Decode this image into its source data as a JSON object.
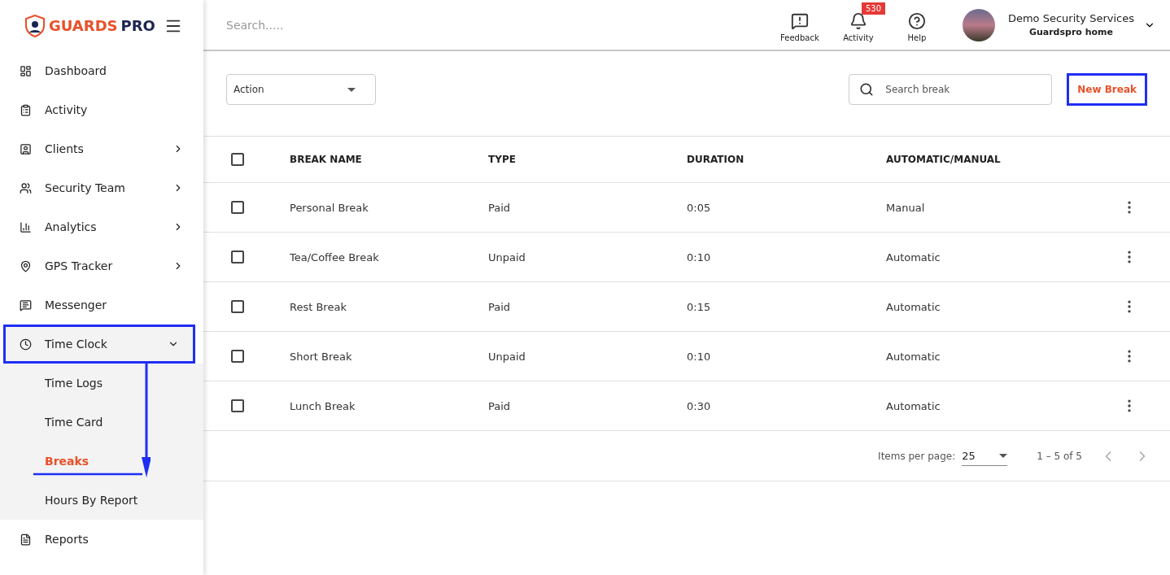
{
  "brand": {
    "name_accent": "GUARDS",
    "name_rest": "PRO"
  },
  "sidebar": {
    "items": [
      {
        "label": "Dashboard",
        "expandable": false,
        "expanded": false
      },
      {
        "label": "Activity",
        "expandable": false,
        "expanded": false
      },
      {
        "label": "Clients",
        "expandable": true,
        "expanded": false
      },
      {
        "label": "Security Team",
        "expandable": true,
        "expanded": false
      },
      {
        "label": "Analytics",
        "expandable": true,
        "expanded": false
      },
      {
        "label": "GPS Tracker",
        "expandable": true,
        "expanded": false
      },
      {
        "label": "Messenger",
        "expandable": false,
        "expanded": false
      },
      {
        "label": "Time Clock",
        "expandable": true,
        "expanded": true,
        "children": [
          {
            "label": "Time Logs",
            "selected": false
          },
          {
            "label": "Time Card",
            "selected": false
          },
          {
            "label": "Breaks",
            "selected": true
          },
          {
            "label": "Hours By Report",
            "selected": false
          }
        ]
      },
      {
        "label": "Reports",
        "expandable": false,
        "expanded": false
      }
    ]
  },
  "topbar": {
    "search": {
      "placeholder": "Search....."
    },
    "actions": [
      {
        "label": "Feedback"
      },
      {
        "label": "Activity",
        "badge": "530"
      },
      {
        "label": "Help"
      }
    ],
    "account": {
      "name": "Demo Security Services",
      "subtitle": "Guardspro home"
    }
  },
  "toolbar": {
    "action": {
      "label": "Action"
    },
    "search": {
      "placeholder": "Search break"
    },
    "new_button": "New Break"
  },
  "table": {
    "all_checked": false,
    "columns": [
      "BREAK NAME",
      "TYPE",
      "DURATION",
      "AUTOMATIC/MANUAL"
    ],
    "rows": [
      {
        "checked": false,
        "cells": [
          "Personal Break",
          "Paid",
          "0:05",
          "Manual"
        ]
      },
      {
        "checked": false,
        "cells": [
          "Tea/Coffee Break",
          "Unpaid",
          "0:10",
          "Automatic"
        ]
      },
      {
        "checked": false,
        "cells": [
          "Rest Break",
          "Paid",
          "0:15",
          "Automatic"
        ]
      },
      {
        "checked": false,
        "cells": [
          "Short Break",
          "Unpaid",
          "0:10",
          "Automatic"
        ]
      },
      {
        "checked": false,
        "cells": [
          "Lunch Break",
          "Paid",
          "0:30",
          "Automatic"
        ]
      }
    ]
  },
  "paginator": {
    "label": "Items per page:",
    "page_size": "25",
    "range": "1 – 5 of 5"
  }
}
